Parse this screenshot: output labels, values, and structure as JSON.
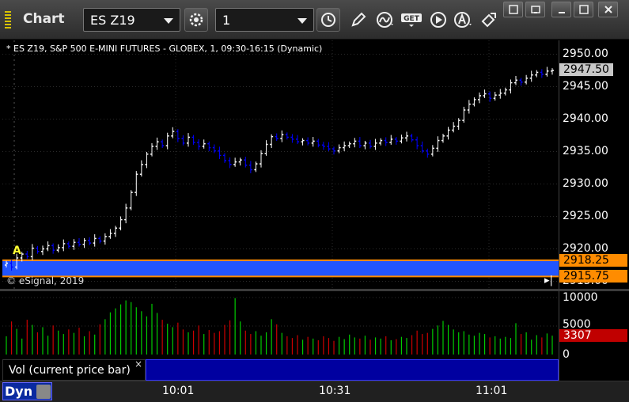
{
  "window": {
    "title": "Chart",
    "symbol": "ES Z19",
    "interval": "1"
  },
  "chart": {
    "symbol_line": "* ES Z19, S&P 500 E-MINI FUTURES - GLOBEX, 1, 09:30-16:15 (Dynamic)",
    "copyright": "© eSignal, 2019",
    "marker_label": "A",
    "price_axis": [
      "2950.00",
      "2945.00",
      "2940.00",
      "2935.00",
      "2930.00",
      "2925.00",
      "2920.00",
      "2915.00"
    ],
    "last_price": "2947.50",
    "level_high": "2918.25",
    "level_low": "2915.75",
    "volume_axis": [
      "10000",
      "5000",
      "0"
    ],
    "last_volume": "3307",
    "time_axis": [
      "10:01",
      "10:31",
      "11:01"
    ],
    "colors": {
      "up": "#ffffff",
      "down": "#0000ff",
      "band": "#2255ff",
      "level": "#ff8c00",
      "vol_up": "#00cc00",
      "vol_down": "#cc0000"
    }
  },
  "study": {
    "label": "Vol (current price bar)",
    "close": "×"
  },
  "footer": {
    "mode": "Dyn"
  },
  "chart_data": {
    "type": "bar",
    "title": "",
    "x_range": [
      "09:30",
      "11:15"
    ],
    "ylim": [
      2913,
      2952
    ],
    "volume_ylim": [
      0,
      11000
    ],
    "level_band": [
      2915.75,
      2918.25
    ],
    "closes": [
      2917.8,
      2917.2,
      2918.6,
      2919.2,
      2918.8,
      2920.1,
      2919.6,
      2920.0,
      2920.5,
      2919.8,
      2920.2,
      2920.8,
      2920.4,
      2921.0,
      2920.7,
      2921.3,
      2920.9,
      2921.6,
      2921.2,
      2921.9,
      2922.4,
      2923.2,
      2924.5,
      2926.3,
      2928.7,
      2931.5,
      2933.0,
      2934.6,
      2935.8,
      2936.5,
      2935.9,
      2937.4,
      2938.1,
      2937.0,
      2936.3,
      2937.2,
      2936.4,
      2935.8,
      2936.2,
      2935.6,
      2935.1,
      2934.4,
      2933.6,
      2933.0,
      2933.4,
      2933.7,
      2932.9,
      2932.2,
      2933.1,
      2934.7,
      2936.1,
      2937.3,
      2937.0,
      2937.6,
      2937.2,
      2936.9,
      2936.5,
      2936.7,
      2936.3,
      2936.6,
      2936.0,
      2935.8,
      2935.4,
      2935.1,
      2935.6,
      2935.9,
      2936.2,
      2936.6,
      2935.9,
      2936.3,
      2935.8,
      2936.3,
      2936.7,
      2936.4,
      2936.9,
      2936.6,
      2937.1,
      2937.4,
      2936.8,
      2935.9,
      2935.1,
      2934.6,
      2935.5,
      2936.7,
      2937.4,
      2938.3,
      2938.9,
      2939.8,
      2941.4,
      2942.3,
      2943.0,
      2943.6,
      2943.9,
      2943.2,
      2943.7,
      2944.0,
      2944.5,
      2945.6,
      2946.0,
      2945.7,
      2946.3,
      2946.8,
      2947.2,
      2946.9,
      2947.4,
      2947.5
    ],
    "volume": [
      3200,
      5800,
      4500,
      2800,
      6100,
      5200,
      3900,
      4800,
      3300,
      5100,
      4200,
      3600,
      4400,
      3800,
      4700,
      3200,
      4100,
      3500,
      5300,
      6200,
      7400,
      8100,
      8800,
      9500,
      9200,
      8300,
      7600,
      6700,
      8900,
      7300,
      6100,
      5400,
      4800,
      5600,
      4400,
      3900,
      4200,
      5100,
      3600,
      4300,
      3800,
      4100,
      5200,
      6000,
      9900,
      5800,
      4200,
      3600,
      4100,
      3300,
      3900,
      6200,
      5300,
      3800,
      3200,
      2900,
      3400,
      2600,
      3100,
      2800,
      2500,
      3200,
      2900,
      2400,
      3100,
      2700,
      3500,
      3000,
      2800,
      3300,
      2600,
      3000,
      2800,
      3200,
      2500,
      2700,
      3100,
      2900,
      3400,
      4200,
      3600,
      3800,
      4500,
      5100,
      5900,
      5200,
      4400,
      3900,
      4100,
      3500,
      3300,
      3800,
      3600,
      3000,
      3200,
      2800,
      3100,
      2900,
      5500,
      3600,
      3900,
      2600,
      3400,
      3000,
      3700,
      3307
    ]
  }
}
